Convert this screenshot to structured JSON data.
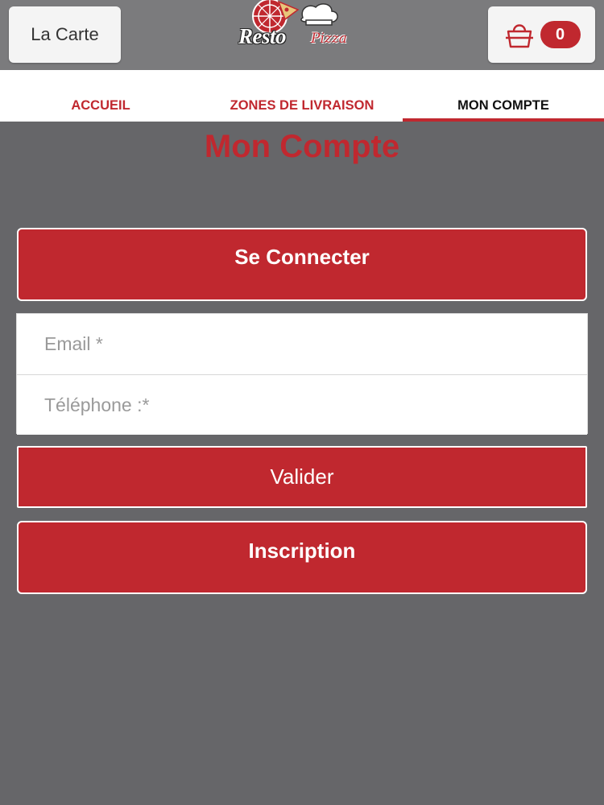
{
  "header": {
    "menu_label": "La Carte",
    "cart_count": "0",
    "logo_text": "Resto",
    "logo_sub": "Pizza"
  },
  "nav": {
    "tabs": [
      {
        "label": "ACCUEIL",
        "active": false
      },
      {
        "label": "ZONES DE LIVRAISON",
        "active": false
      },
      {
        "label": "MON COMPTE",
        "active": true
      }
    ]
  },
  "main": {
    "title": "Mon Compte",
    "connect_label": "Se Connecter",
    "email_placeholder": "Email *",
    "phone_placeholder": "Téléphone :*",
    "submit_label": "Valider",
    "signup_label": "Inscription"
  },
  "colors": {
    "accent": "#c0282f",
    "background": "#666669",
    "header": "#7b7b7d"
  }
}
